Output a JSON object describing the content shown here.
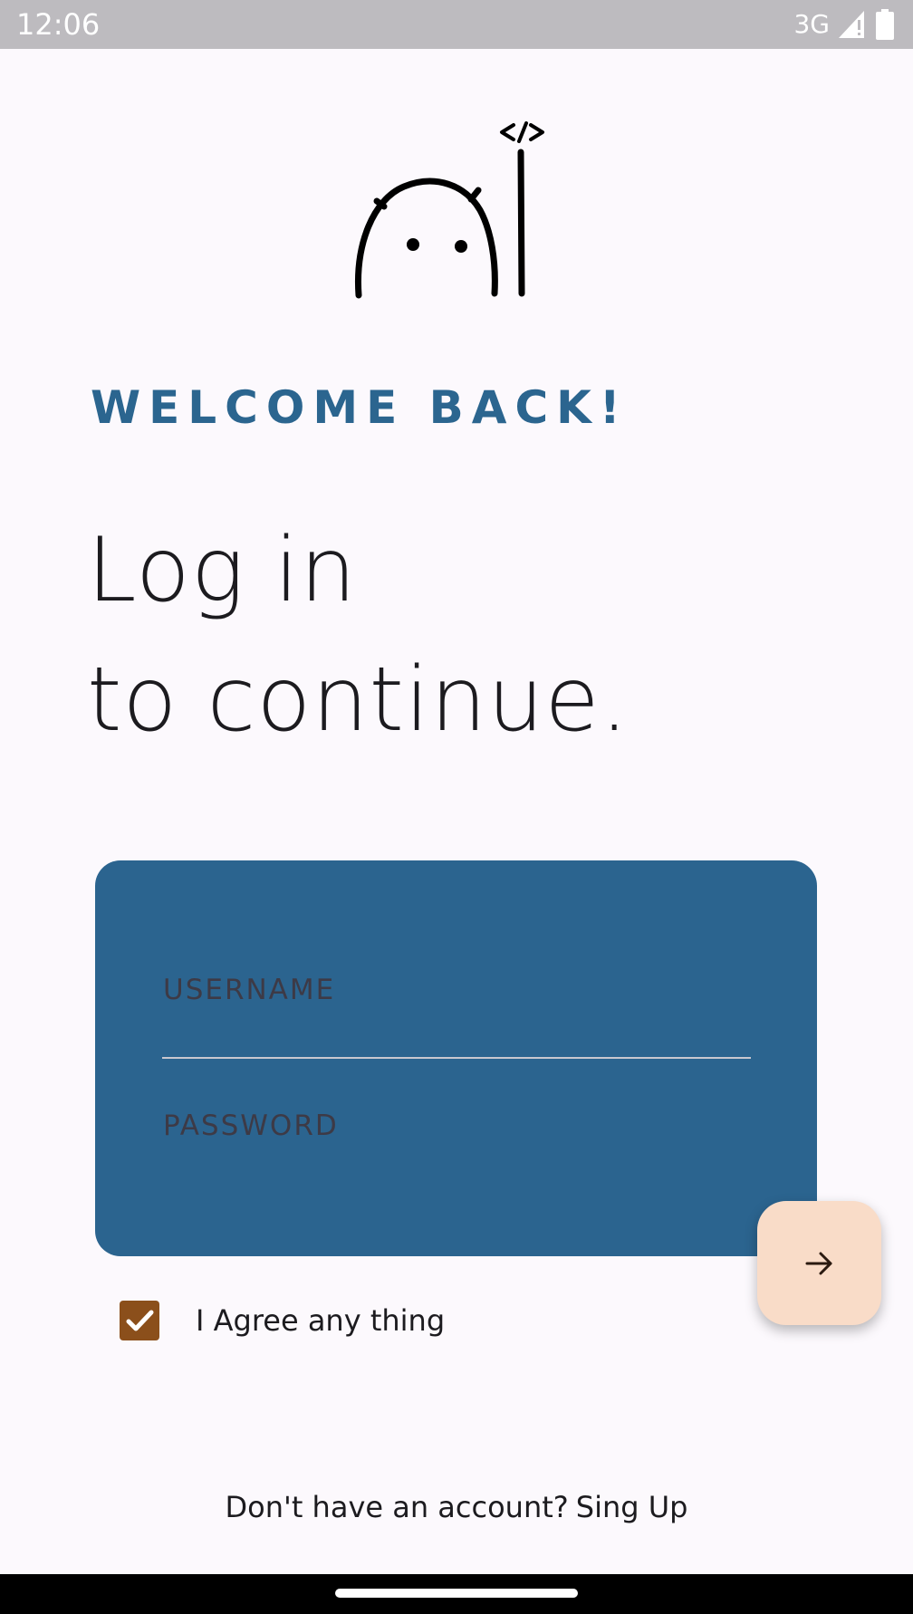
{
  "status_bar": {
    "time": "12:06",
    "network": "3G",
    "signal_icon": "cell-signal-icon",
    "battery_icon": "battery-icon"
  },
  "header": {
    "welcome": "WELCOME BACK!",
    "heading_line1": "Log in",
    "heading_line2": "to continue."
  },
  "form": {
    "username_label": "USERNAME",
    "password_label": "PASSWORD",
    "submit_icon": "arrow-right-icon"
  },
  "agreement": {
    "checked": true,
    "label": "I Agree any thing"
  },
  "footer": {
    "prompt": "Don't have an account?",
    "signup_link": "Sing Up"
  },
  "colors": {
    "brand_blue": "#2b648f",
    "accent_brown": "#8b4f1b",
    "fab_background": "#f9dcc8",
    "page_background": "#fcf9fd"
  }
}
